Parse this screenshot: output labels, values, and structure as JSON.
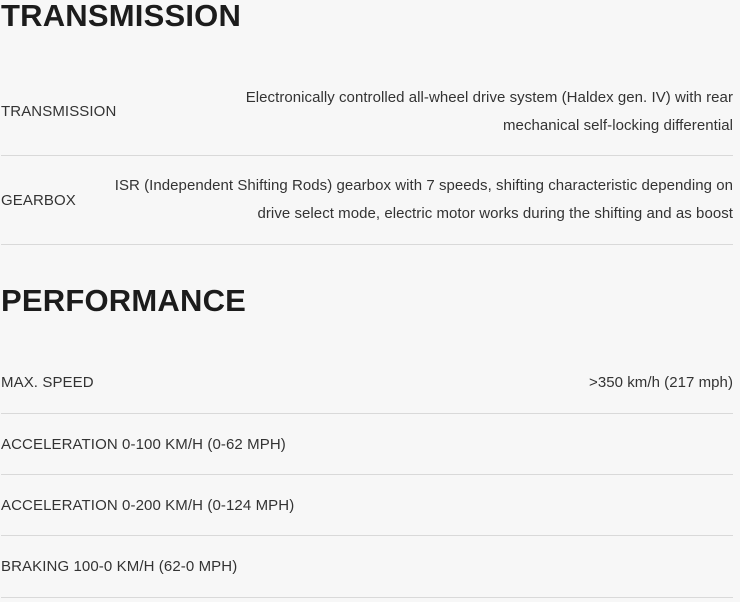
{
  "sections": {
    "transmission": {
      "title": "TRANSMISSION",
      "rows": [
        {
          "label": "TRANSMISSION",
          "value": "Electronically controlled all-wheel drive system (Haldex gen. IV) with rear mechanical self-locking differential"
        },
        {
          "label": "GEARBOX",
          "value": "ISR (Independent Shifting Rods) gearbox with 7 speeds, shifting characteristic depending on drive select mode, electric motor works during the shifting and as boost"
        }
      ]
    },
    "performance": {
      "title": "PERFORMANCE",
      "rows": [
        {
          "label": "MAX. SPEED",
          "value": ">350 km/h (217 mph)"
        },
        {
          "label": "ACCELERATION 0-100 KM/H (0-62 MPH)",
          "value": ""
        },
        {
          "label": "ACCELERATION 0-200 KM/H (0-124 MPH)",
          "value": ""
        },
        {
          "label": "BRAKING 100-0 KM/H (62-0 MPH)",
          "value": ""
        }
      ]
    }
  }
}
